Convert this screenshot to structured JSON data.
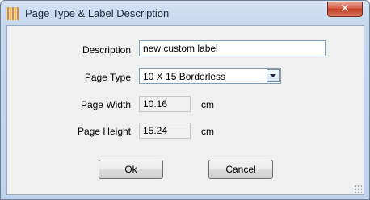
{
  "window": {
    "title": "Page Type & Label Description",
    "close_glyph": "✕"
  },
  "form": {
    "description": {
      "label": "Description",
      "value": "new custom label"
    },
    "page_type": {
      "label": "Page Type",
      "value": "10 X 15 Borderless"
    },
    "page_width": {
      "label": "Page Width",
      "value": "10.16",
      "unit": "cm"
    },
    "page_height": {
      "label": "Page Height",
      "value": "15.24",
      "unit": "cm"
    }
  },
  "buttons": {
    "ok": "Ok",
    "cancel": "Cancel"
  }
}
